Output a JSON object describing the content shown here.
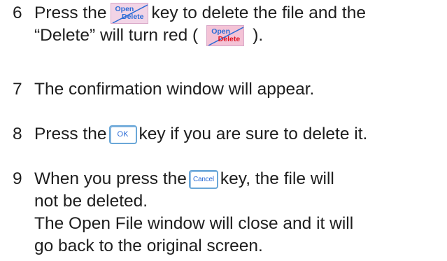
{
  "steps": [
    {
      "number": "6",
      "line1_before": "Press the",
      "line1_after": "key to delete the file and the",
      "line2_before": "“Delete” will turn red (",
      "line2_after": ")."
    },
    {
      "number": "7",
      "text": "The confirmation window will appear."
    },
    {
      "number": "8",
      "before": "Press the",
      "after": "key if you are sure to delete it."
    },
    {
      "number": "9",
      "line1_before": "When you press the",
      "line1_after": "key, the file will",
      "line2": "not be deleted.",
      "line3": "The Open File window will close and it will",
      "line4": "go back to the original screen."
    }
  ],
  "keys": {
    "open_delete": {
      "top": "Open",
      "bottom": "Delete",
      "color_normal": "#2a6bd6",
      "color_active": "#e0121f",
      "bg": "#f2d4e6"
    },
    "ok": "OK",
    "cancel": "Cancel"
  }
}
